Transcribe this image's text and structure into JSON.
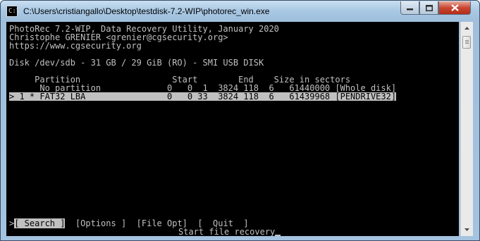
{
  "window": {
    "title": "C:\\Users\\cristiangallo\\Desktop\\testdisk-7.2-WIP\\photorec_win.exe",
    "icon_prompt": "C:\\",
    "min_icon": "minimize-icon",
    "max_icon": "maximize-icon",
    "close_icon": "close-icon"
  },
  "header": {
    "line1": "PhotoRec 7.2-WIP, Data Recovery Utility, January 2020",
    "line2": "Christophe GRENIER <grenier@cgsecurity.org>",
    "line3": "https://www.cgsecurity.org"
  },
  "disk": {
    "info": "Disk /dev/sdb - 31 GB / 29 GiB (RO) - SMI USB DISK"
  },
  "table": {
    "header": "     Partition                  Start        End    Size in sectors",
    "rows": [
      "      No partition             0   0  1  3824 118  6   61440000 [Whole disk]",
      "> 1 * FAT32 LBA                0   0 33  3824 118  6   61439968 [PENDRIVE32]"
    ]
  },
  "menu": {
    "selector": ">",
    "search": "[ Search ]",
    "options": "[Options ]",
    "file_opt": "[File Opt]",
    "quit": "[  Quit  ]"
  },
  "status": {
    "hint": "Start file recovery"
  },
  "colors": {
    "console_bg": "#000000",
    "console_fg": "#c0c0c0",
    "highlight_bg": "#c0c0c0",
    "highlight_fg": "#000000"
  }
}
